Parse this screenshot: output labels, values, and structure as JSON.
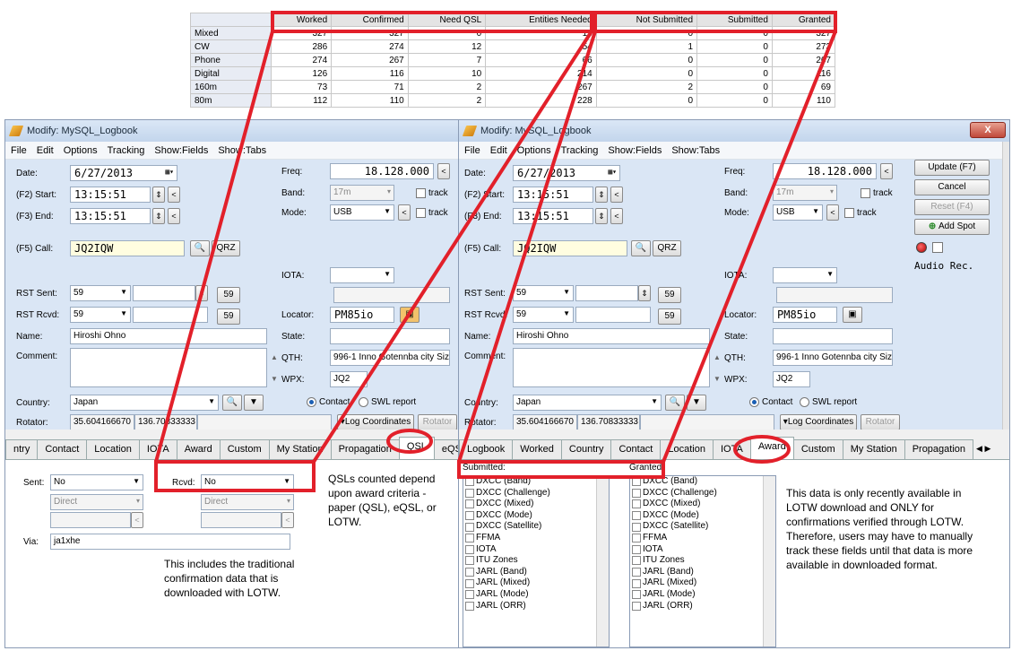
{
  "summary_table": {
    "columns": [
      "",
      "Worked",
      "Confirmed",
      "Need QSL",
      "Entities Needed",
      "Not Submitted",
      "Submitted",
      "Granted"
    ],
    "rows": [
      {
        "label": "Mixed",
        "values": [
          "327",
          "327",
          "0",
          "13",
          "0",
          "0",
          "327"
        ]
      },
      {
        "label": "CW",
        "values": [
          "286",
          "274",
          "12",
          "54",
          "1",
          "0",
          "273"
        ]
      },
      {
        "label": "Phone",
        "values": [
          "274",
          "267",
          "7",
          "66",
          "0",
          "0",
          "267"
        ]
      },
      {
        "label": "Digital",
        "values": [
          "126",
          "116",
          "10",
          "214",
          "0",
          "0",
          "116"
        ]
      },
      {
        "label": "160m",
        "values": [
          "73",
          "71",
          "2",
          "267",
          "2",
          "0",
          "69"
        ]
      },
      {
        "label": "80m",
        "values": [
          "112",
          "110",
          "2",
          "228",
          "0",
          "0",
          "110"
        ]
      }
    ]
  },
  "window": {
    "title": "Modify: MySQL_Logbook",
    "menu": [
      "File",
      "Edit",
      "Options",
      "Tracking",
      "Show:Fields",
      "Show:Tabs"
    ],
    "close_label": "X"
  },
  "form": {
    "date_label": "Date:",
    "date": "6/27/2013",
    "start_label": "(F2) Start:",
    "start": "13:15:51",
    "end_label": "(F3) End:",
    "end": "13:15:51",
    "call_label": "(F5) Call:",
    "call": "JQ2IQW",
    "qrz": "QRZ",
    "freq_label": "Freq:",
    "freq": "18.128.000",
    "band_label": "Band:",
    "band": "17m",
    "mode_label": "Mode:",
    "mode": "USB",
    "track": "track",
    "iota_label": "IOTA:",
    "rst_sent_label": "RST Sent:",
    "rst_sent": "59",
    "rst_btn": "59",
    "rst_rcvd_label": "RST Rcvd:",
    "rst_rcvd": "59",
    "locator_label": "Locator:",
    "locator": "PM85io",
    "name_label": "Name:",
    "name": "Hiroshi Ohno",
    "state_label": "State:",
    "comment_label": "Comment:",
    "qth_label": "QTH:",
    "qth": "996-1 Inno Gotennba city Sizu",
    "wpx_label": "WPX:",
    "wpx": "JQ2",
    "country_label": "Country:",
    "country": "Japan",
    "contact": "Contact",
    "swl": "SWL report",
    "rotator_label": "Rotator:",
    "lat": "35.604166670",
    "lon": "136.70833333",
    "log_coords": "Log Coordinates",
    "rotator_btn": "Rotator"
  },
  "side_buttons": {
    "update": "Update (F7)",
    "cancel": "Cancel",
    "reset": "Reset (F4)",
    "add_spot": "Add Spot",
    "audio_rec": "Audio Rec."
  },
  "left_tabs": [
    "ntry",
    "Contact",
    "Location",
    "IOTA",
    "Award",
    "Custom",
    "My Station",
    "Propagation",
    "QSL",
    "eQSL"
  ],
  "right_tabs": [
    "Logbook",
    "Worked",
    "Country",
    "Contact",
    "Location",
    "IOTA",
    "Award",
    "Custom",
    "My Station",
    "Propagation"
  ],
  "qsl_panel": {
    "sent_label": "Sent:",
    "sent": "No",
    "rcvd_label": "Rcvd:",
    "rcvd": "No",
    "direct": "Direct",
    "via_label": "Via:",
    "via": "ja1xhe"
  },
  "award_panel": {
    "submitted_label": "Submitted:",
    "granted_label": "Granted:",
    "items": [
      "DXCC (Band)",
      "DXCC (Challenge)",
      "DXCC (Mixed)",
      "DXCC (Mode)",
      "DXCC (Satellite)",
      "FFMA",
      "IOTA",
      "ITU Zones",
      "JARL (Band)",
      "JARL (Mixed)",
      "JARL (Mode)",
      "JARL (ORR)"
    ]
  },
  "notes": {
    "qsl_note": "QSLs counted depend upon award criteria - paper (QSL), eQSL, or LOTW.",
    "traditional_note": "This includes the traditional confirmation data that is downloaded with LOTW.",
    "lotw_note": "This data is only recently available in LOTW download and ONLY for confirmations verified through LOTW. Therefore, users may have to manually track these fields until that data is more available in downloaded format."
  }
}
